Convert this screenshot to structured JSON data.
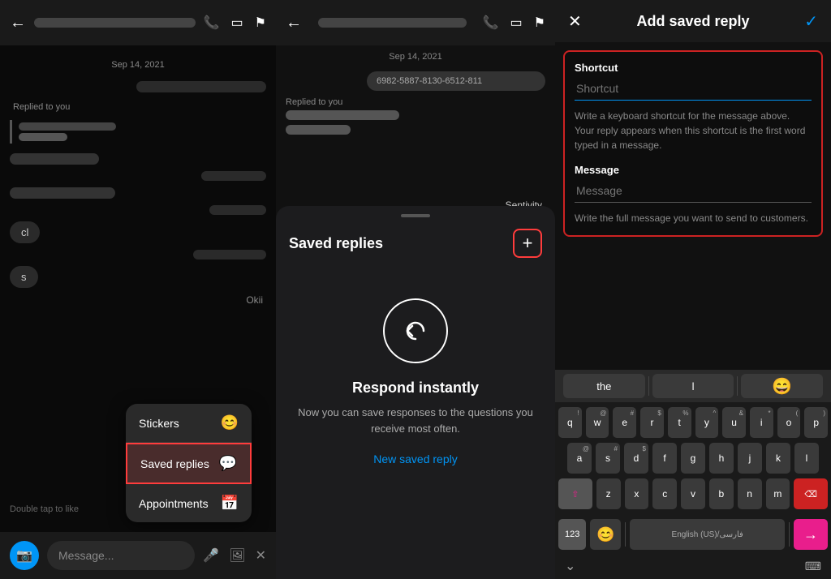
{
  "panel1": {
    "header": {
      "back_icon": "←",
      "name_placeholder": "",
      "call_icon": "📞",
      "video_icon": "▭",
      "flag_icon": "⚑"
    },
    "date_label": "Sep 14, 2021",
    "replied_label": "Replied to you",
    "messages": [
      {
        "type": "right",
        "width": 160
      },
      {
        "type": "left",
        "width": 80
      },
      {
        "type": "left",
        "width": 110
      },
      {
        "type": "right",
        "width": 90
      },
      {
        "type": "left",
        "width": 130
      }
    ],
    "cl_text": "cl",
    "s_text": "s",
    "double_tap": "Double tap to like",
    "okii_label": "Okii",
    "context_menu": {
      "items": [
        {
          "label": "Stickers",
          "icon": "😊"
        },
        {
          "label": "Saved replies",
          "icon": "💬",
          "active": true
        },
        {
          "label": "Appointments",
          "icon": "📅"
        }
      ]
    },
    "bottom_bar": {
      "message_placeholder": "Message...",
      "mic_icon": "🎤",
      "gallery_icon": "🖼",
      "close_icon": "✕"
    }
  },
  "panel2": {
    "header": {
      "back_icon": "←",
      "name_placeholder": "",
      "call_icon": "📞",
      "video_icon": "▭",
      "flag_icon": "⚑"
    },
    "date_label": "Sep 14, 2021",
    "phone_number": "6982-5887-8130-6512-811",
    "replied_label": "Replied to you",
    "sentivity_label": "Sentivity",
    "sheet": {
      "title": "Saved replies",
      "add_icon": "+",
      "empty": {
        "title": "Respond instantly",
        "description": "Now you can save responses to the questions you receive most often.",
        "new_reply_link": "New saved reply"
      }
    }
  },
  "panel3": {
    "header": {
      "close_icon": "✕",
      "title": "Add saved reply",
      "check_icon": "✓"
    },
    "form": {
      "shortcut_label": "Shortcut",
      "shortcut_placeholder": "Shortcut",
      "shortcut_hint": "Write a keyboard shortcut for the message above. Your reply appears when this shortcut is the first word typed in a message.",
      "message_label": "Message",
      "message_placeholder": "Message",
      "message_hint": "Write the full message you want to send to customers."
    },
    "keyboard": {
      "suggestions": [
        "the",
        "l",
        "😄"
      ],
      "rows": [
        [
          "q",
          "w",
          "e",
          "r",
          "t",
          "y",
          "u",
          "i",
          "o",
          "p"
        ],
        [
          "a",
          "s",
          "d",
          "f",
          "g",
          "h",
          "j",
          "k",
          "l"
        ],
        [
          "⇧",
          "z",
          "x",
          "c",
          "v",
          "b",
          "n",
          "m",
          "⌫"
        ],
        [
          "123",
          "😊",
          "",
          "English (US)/فارسی",
          "→"
        ]
      ]
    }
  }
}
